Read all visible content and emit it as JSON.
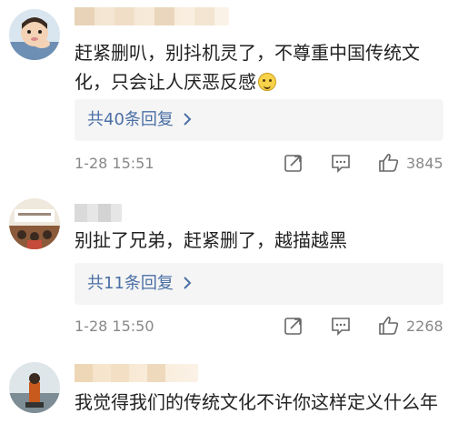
{
  "comments": [
    {
      "text": "赶紧删叭，别抖机灵了，不尊重中国传统文化，只会让人厌恶反感",
      "emoji_icon": "hug-face-emoji",
      "replies": "共40条回复",
      "time": "1-28 15:51",
      "likes": "3845"
    },
    {
      "text": "别扯了兄弟，赶紧删了，越描越黑",
      "replies": "共11条回复",
      "time": "1-28 15:50",
      "likes": "2268"
    },
    {
      "text": "我觉得我们的传统文化不许你这样定义什么年"
    }
  ],
  "icons": {
    "share": "share-icon",
    "comment": "comment-icon",
    "like": "thumbs-up-icon",
    "reply_arrow": "chevron-right-icon"
  },
  "colors": {
    "link": "#4a6fa5",
    "meta": "#888888",
    "reply_bg": "#f5f5f5"
  }
}
